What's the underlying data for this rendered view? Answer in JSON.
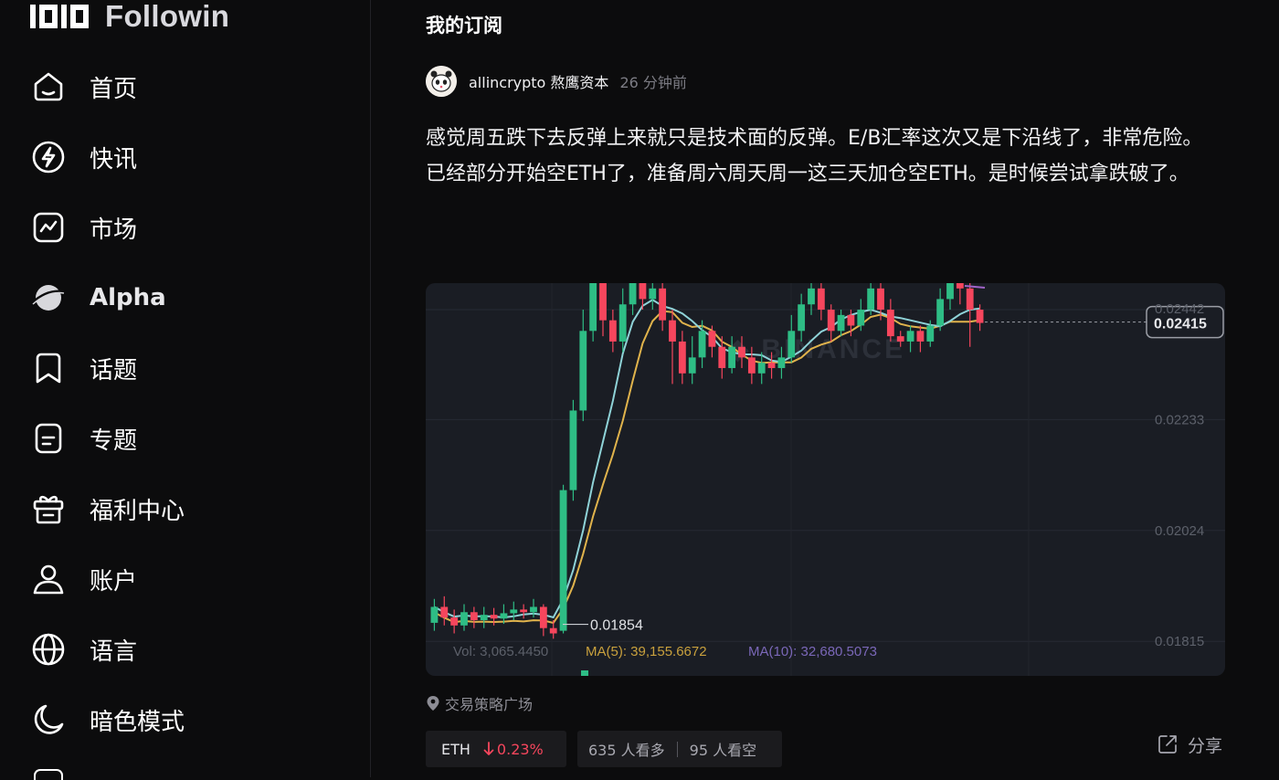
{
  "brand": {
    "name": "Followin"
  },
  "nav": {
    "items": [
      {
        "id": "home",
        "label": "首页",
        "icon": "home-icon"
      },
      {
        "id": "flash",
        "label": "快讯",
        "icon": "flash-icon"
      },
      {
        "id": "market",
        "label": "市场",
        "icon": "market-chart-icon"
      },
      {
        "id": "alpha",
        "label": "Alpha",
        "icon": "planet-icon"
      },
      {
        "id": "topics",
        "label": "话题",
        "icon": "bookmark-icon"
      },
      {
        "id": "specials",
        "label": "专题",
        "icon": "document-icon"
      },
      {
        "id": "rewards",
        "label": "福利中心",
        "icon": "gift-icon"
      },
      {
        "id": "account",
        "label": "账户",
        "icon": "user-icon"
      },
      {
        "id": "language",
        "label": "语言",
        "icon": "globe-icon"
      },
      {
        "id": "darkmode",
        "label": "暗色模式",
        "icon": "moon-icon"
      }
    ]
  },
  "main": {
    "title": "我的订阅"
  },
  "post": {
    "author": "allincrypto 熬鹰资本",
    "time": "26 分钟前",
    "paragraph1": "感觉周五跌下去反弹上来就只是技术面的反弹。E/B汇率这次又是下沿线了，非常危险。",
    "paragraph2": "已经部分开始空ETH了，准备周六周天周一这三天加仓空ETH。是时候尝试拿跌破了。",
    "location": "交易策略广场",
    "coin": {
      "symbol": "ETH",
      "change": "0.23%",
      "direction": "down"
    },
    "votes": {
      "bullish": "635 人看多",
      "bearish": "95 人看空"
    },
    "share_label": "分享"
  },
  "chart_data": {
    "type": "candlestick",
    "watermark": "BINANCE",
    "price_axis": [
      "0.02442",
      "0.02233",
      "0.02024",
      "0.01815"
    ],
    "current_price": "0.02415",
    "low_marker": "0.01854",
    "y_range": [
      0.0175,
      0.0249
    ],
    "footer": {
      "vol": "Vol: 3,065.4450",
      "ma5": "MA(5): 39,155.6672",
      "ma10": "MA(10): 32,680.5073"
    },
    "colors": {
      "up": "#2ebd85",
      "down": "#f6465d",
      "ma_fast": "#8fd3d8",
      "ma_slow": "#e0b34c",
      "background": "#1a1d24"
    },
    "candles": [
      [
        0.0185,
        0.0188,
        0.01835,
        0.01895
      ],
      [
        0.0188,
        0.0186,
        0.01845,
        0.019
      ],
      [
        0.0186,
        0.01845,
        0.0183,
        0.01875
      ],
      [
        0.01845,
        0.0187,
        0.01835,
        0.01885
      ],
      [
        0.0187,
        0.01855,
        0.0184,
        0.0188
      ],
      [
        0.01855,
        0.01865,
        0.0184,
        0.0188
      ],
      [
        0.01865,
        0.01858,
        0.01845,
        0.01878
      ],
      [
        0.01858,
        0.01868,
        0.01848,
        0.01885
      ],
      [
        0.01868,
        0.01875,
        0.01855,
        0.0189
      ],
      [
        0.01875,
        0.0187,
        0.01858,
        0.01885
      ],
      [
        0.0187,
        0.0188,
        0.0186,
        0.01895
      ],
      [
        0.0188,
        0.0184,
        0.01825,
        0.01885
      ],
      [
        0.0184,
        0.0183,
        0.0182,
        0.01855
      ],
      [
        0.01835,
        0.021,
        0.0183,
        0.0211
      ],
      [
        0.021,
        0.0225,
        0.0208,
        0.0227
      ],
      [
        0.0225,
        0.024,
        0.0223,
        0.0244
      ],
      [
        0.024,
        0.025,
        0.0238,
        0.0252
      ],
      [
        0.025,
        0.0242,
        0.0239,
        0.0253
      ],
      [
        0.0242,
        0.0238,
        0.0236,
        0.0244
      ],
      [
        0.0238,
        0.0245,
        0.0236,
        0.0248
      ],
      [
        0.0245,
        0.0252,
        0.0243,
        0.0254
      ],
      [
        0.0252,
        0.0246,
        0.0244,
        0.0254
      ],
      [
        0.0246,
        0.0248,
        0.0244,
        0.025
      ],
      [
        0.0248,
        0.0242,
        0.024,
        0.025
      ],
      [
        0.0242,
        0.0238,
        0.023,
        0.0244
      ],
      [
        0.0238,
        0.0232,
        0.023,
        0.024
      ],
      [
        0.0232,
        0.0235,
        0.023,
        0.0239
      ],
      [
        0.0235,
        0.024,
        0.0233,
        0.0242
      ],
      [
        0.024,
        0.0237,
        0.0235,
        0.0241
      ],
      [
        0.0237,
        0.0233,
        0.0231,
        0.0239
      ],
      [
        0.0233,
        0.0237,
        0.0232,
        0.0239
      ],
      [
        0.0237,
        0.0235,
        0.0233,
        0.0239
      ],
      [
        0.0235,
        0.0232,
        0.023,
        0.0237
      ],
      [
        0.0232,
        0.0234,
        0.023,
        0.0236
      ],
      [
        0.0234,
        0.0233,
        0.0231,
        0.0236
      ],
      [
        0.0233,
        0.0235,
        0.0231,
        0.0237
      ],
      [
        0.0235,
        0.024,
        0.0234,
        0.0243
      ],
      [
        0.024,
        0.0245,
        0.0238,
        0.0247
      ],
      [
        0.0245,
        0.0248,
        0.0243,
        0.0251
      ],
      [
        0.0248,
        0.0244,
        0.0242,
        0.0249
      ],
      [
        0.0244,
        0.024,
        0.0238,
        0.0245
      ],
      [
        0.024,
        0.0243,
        0.0239,
        0.0244
      ],
      [
        0.0243,
        0.0241,
        0.0239,
        0.0244
      ],
      [
        0.0241,
        0.0244,
        0.024,
        0.0246
      ],
      [
        0.0244,
        0.0248,
        0.0243,
        0.0251
      ],
      [
        0.0248,
        0.0244,
        0.0242,
        0.0249
      ],
      [
        0.0244,
        0.0239,
        0.0238,
        0.0246
      ],
      [
        0.0239,
        0.0238,
        0.0237,
        0.024
      ],
      [
        0.0238,
        0.024,
        0.0236,
        0.0241
      ],
      [
        0.024,
        0.0238,
        0.0236,
        0.0241
      ],
      [
        0.0238,
        0.0241,
        0.0237,
        0.0242
      ],
      [
        0.0241,
        0.0246,
        0.024,
        0.0248
      ],
      [
        0.0246,
        0.0251,
        0.0244,
        0.0253
      ],
      [
        0.0251,
        0.0248,
        0.0245,
        0.0253
      ],
      [
        0.0248,
        0.0244,
        0.0237,
        0.0249
      ],
      [
        0.0244,
        0.02415,
        0.024,
        0.0245
      ]
    ]
  }
}
